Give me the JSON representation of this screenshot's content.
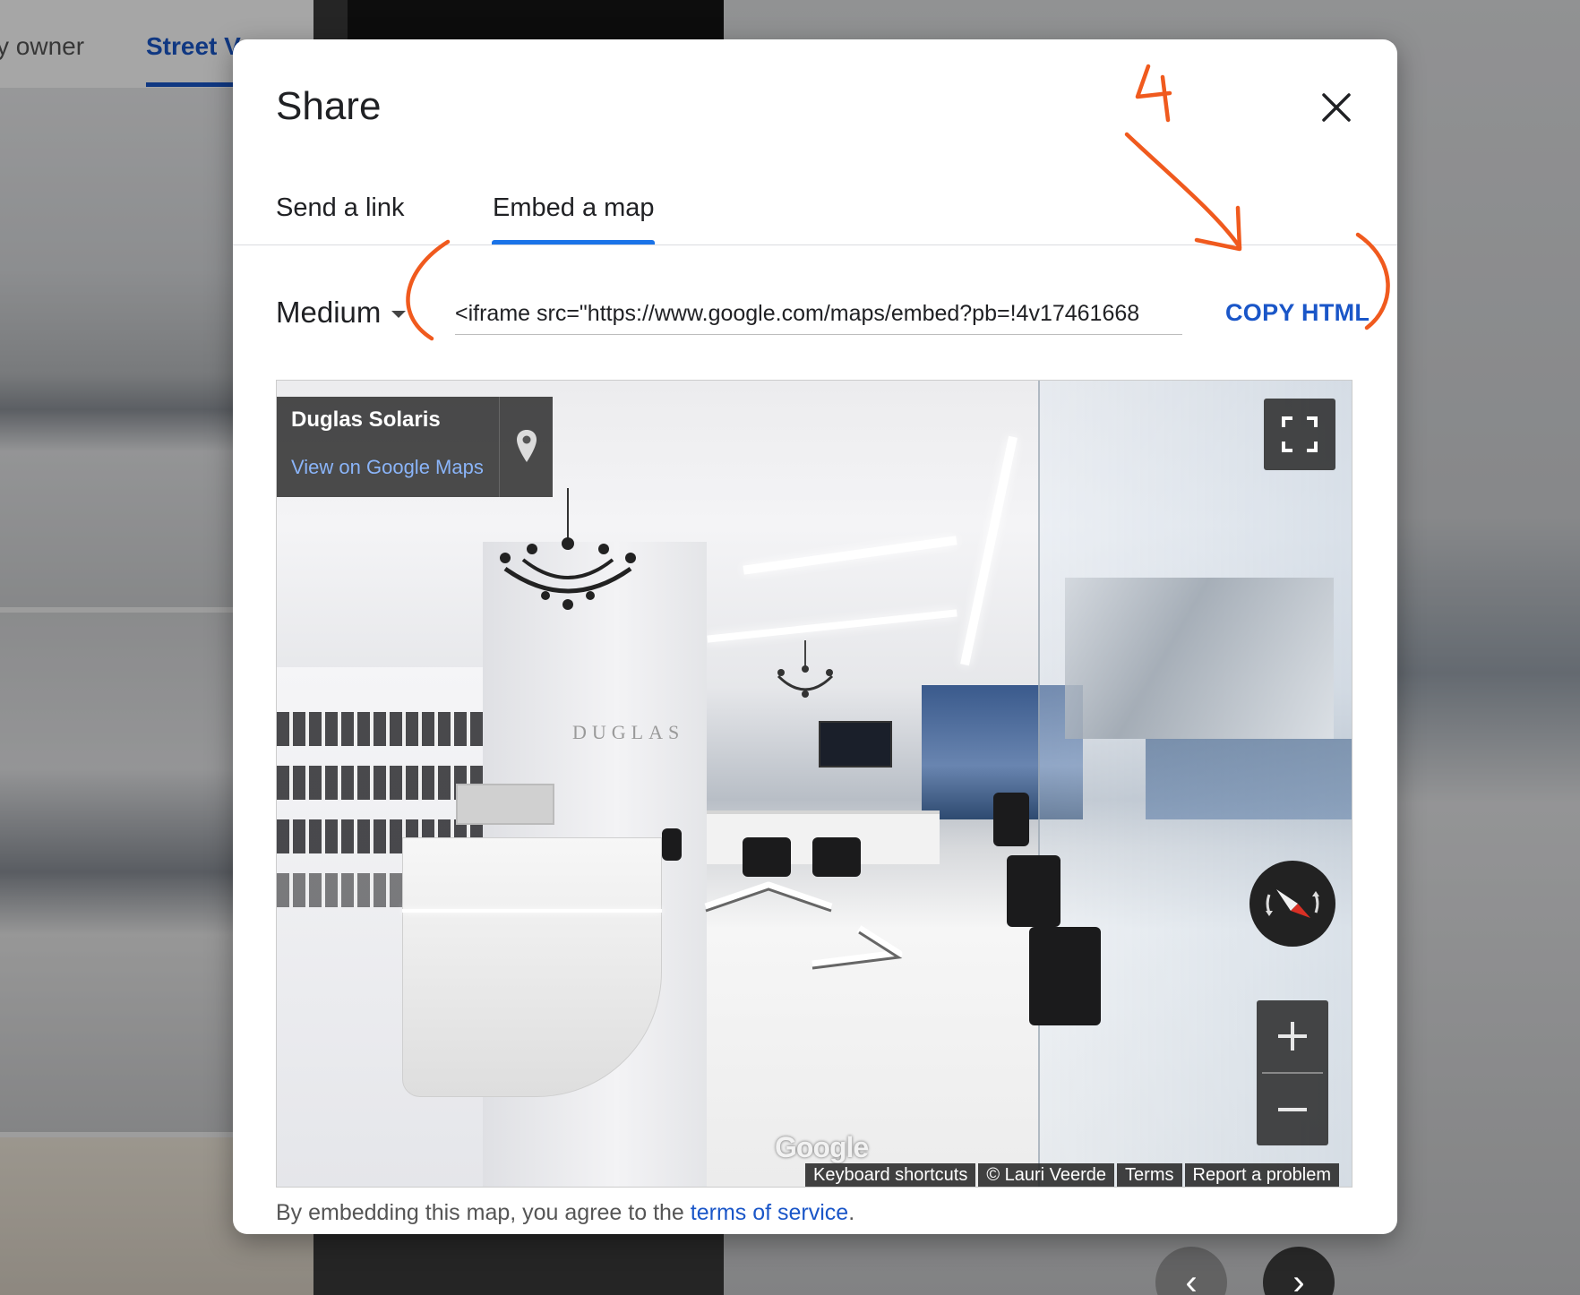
{
  "background": {
    "tabs": [
      {
        "label": "y owner"
      },
      {
        "label": "Street V"
      }
    ],
    "nav": {
      "prev": "‹",
      "next": "›"
    }
  },
  "dialog": {
    "title": "Share",
    "tabs": [
      {
        "label": "Send a link"
      },
      {
        "label": "Embed a map"
      }
    ],
    "active_tab": "Embed a map",
    "size_select": {
      "value": "Medium"
    },
    "embed_code": "<iframe src=\"https://www.google.com/maps/embed?pb=!4v17461668",
    "copy_button": "COPY HTML",
    "preview": {
      "place_name": "Duglas Solaris",
      "view_link": "View on Google Maps",
      "pillar_text": "DUGLAS",
      "logo": "Google",
      "footer": [
        "Keyboard shortcuts",
        "© Lauri Veerde",
        "Terms",
        "Report a problem"
      ]
    },
    "terms": {
      "prefix": "By embedding this map, you agree to the ",
      "link": "terms of service",
      "suffix": "."
    }
  },
  "annotation": {
    "step_number": "4",
    "color": "#f05a1e"
  },
  "colors": {
    "accent": "#1a73e8",
    "link": "#1a56c8"
  }
}
